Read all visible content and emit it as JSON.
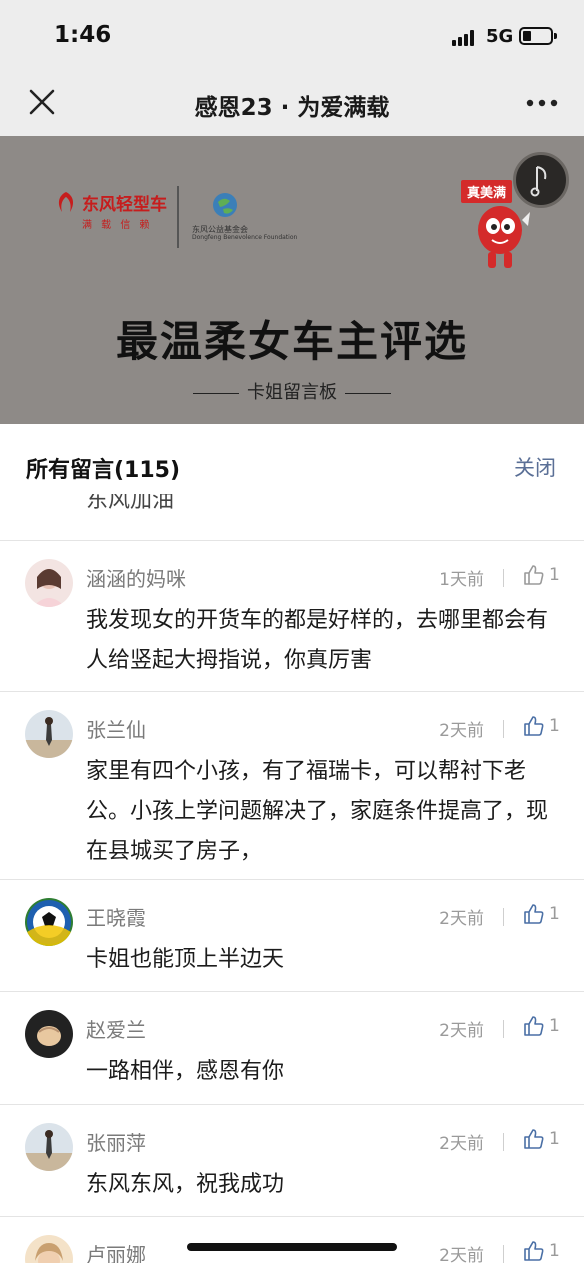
{
  "status_bar": {
    "time": "1:46",
    "network": "5G"
  },
  "nav": {
    "title": "感恩23 · 为爱满载",
    "close_icon": "close-icon",
    "more_icon": "more-icon"
  },
  "banner": {
    "brand_name": "东风轻型车",
    "brand_sub": "满 载 信 赖",
    "foundation_name": "东风公益基金会",
    "foundation_en": "Dongfeng Benevolence Foundation",
    "mascot_tag": "真美满",
    "title": "最温柔女车主评选",
    "subtitle": "卡姐留言板",
    "colors": {
      "brand_red": "#c61d1d",
      "overlay": "#4a4643"
    }
  },
  "sheet": {
    "title": "所有留言(115)",
    "close_label": "关闭",
    "partial_comment": "东风加油",
    "comments": [
      {
        "name": "涵涵的妈咪",
        "time": "1天前",
        "likes": "1",
        "liked": false,
        "text": "我发现女的开货车的都是好样的，去哪里都会有人给竖起大拇指说，你真厉害"
      },
      {
        "name": "张兰仙",
        "time": "2天前",
        "likes": "1",
        "liked": true,
        "text": "家里有四个小孩，有了福瑞卡，可以帮衬下老公。小孩上学问题解决了，家庭条件提高了，现在县城买了房子，"
      },
      {
        "name": "王晓霞",
        "time": "2天前",
        "likes": "1",
        "liked": true,
        "text": "卡姐也能顶上半边天"
      },
      {
        "name": "赵爱兰",
        "time": "2天前",
        "likes": "1",
        "liked": true,
        "text": "一路相伴，感恩有你"
      },
      {
        "name": "张丽萍",
        "time": "2天前",
        "likes": "1",
        "liked": true,
        "text": "东风东风，祝我成功"
      },
      {
        "name": "卢丽娜",
        "time": "2天前",
        "likes": "1",
        "liked": true,
        "text": ""
      }
    ],
    "colors": {
      "accent": "#5a6f96",
      "like_active": "#4a6fa5",
      "like_inactive": "#9a9a9a"
    }
  }
}
